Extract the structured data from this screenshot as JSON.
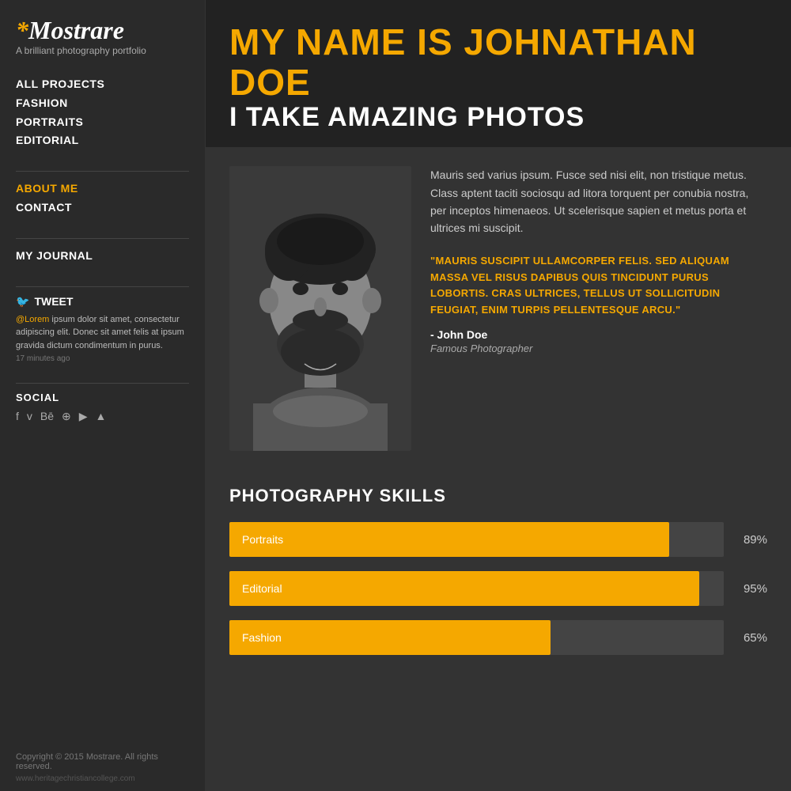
{
  "sidebar": {
    "logo": {
      "star": "*",
      "name": "Mostrare",
      "subtitle": "A brilliant photography portfolio"
    },
    "nav": {
      "items": [
        {
          "label": "ALL PROJECTS",
          "highlight": false
        },
        {
          "label": "FASHION",
          "highlight": false
        },
        {
          "label": "PORTRAITS",
          "highlight": false
        },
        {
          "label": "EDITORIAL",
          "highlight": false
        }
      ],
      "secondary": [
        {
          "label": "ABOUT ME",
          "highlight": true
        },
        {
          "label": "CONTACT",
          "highlight": false
        }
      ],
      "tertiary": [
        {
          "label": "MY JOURNAL",
          "highlight": false
        }
      ]
    },
    "tweet": {
      "header": "TWEET",
      "at_user": "@Lorem",
      "text": " ipsum dolor sit amet, consectetur adipiscing elit. Donec sit amet felis at ipsum gravida dictum condimentum in purus.",
      "time": "17 minutes ago"
    },
    "social": {
      "label": "SOCIAL",
      "icons": [
        "f",
        "v",
        "Be",
        "⊕",
        "▶",
        "▲"
      ]
    },
    "copyright": "Copyright © 2015 Mostrare.\nAll rights reserved.",
    "website": "www.heritagechristiancollege.com"
  },
  "hero": {
    "line1": "MY NAME IS JOHNATHAN DOE",
    "line2": "I TAKE AMAZING PHOTOS"
  },
  "about": {
    "description": "Mauris sed varius ipsum. Fusce sed nisi elit, non tristique metus. Class aptent taciti sociosqu ad litora torquent per conubia nostra, per inceptos himenaeos. Ut scelerisque sapien et metus porta et ultrices mi suscipit.",
    "quote": "\"MAURIS SUSCIPIT ULLAMCORPER FELIS. SED ALIQUAM MASSA VEL RISUS DAPIBUS QUIS TINCIDUNT PURUS LOBORTIS. CRAS ULTRICES, TELLUS UT SOLLICITUDIN FEUGIAT, ENIM TURPIS PELLENTESQUE ARCU.\"",
    "author": "- John Doe",
    "role": "Famous Photographer"
  },
  "skills": {
    "title": "PHOTOGRAPHY SKILLS",
    "items": [
      {
        "name": "Portraits",
        "percent": 89,
        "label": "89%"
      },
      {
        "name": "Editorial",
        "percent": 95,
        "label": "95%"
      },
      {
        "name": "Fashion",
        "percent": 65,
        "label": "65%"
      }
    ]
  },
  "colors": {
    "accent": "#f5a800",
    "bg_dark": "#2a2a2a",
    "bg_mid": "#333",
    "text_light": "#fff",
    "text_muted": "#aaa"
  }
}
